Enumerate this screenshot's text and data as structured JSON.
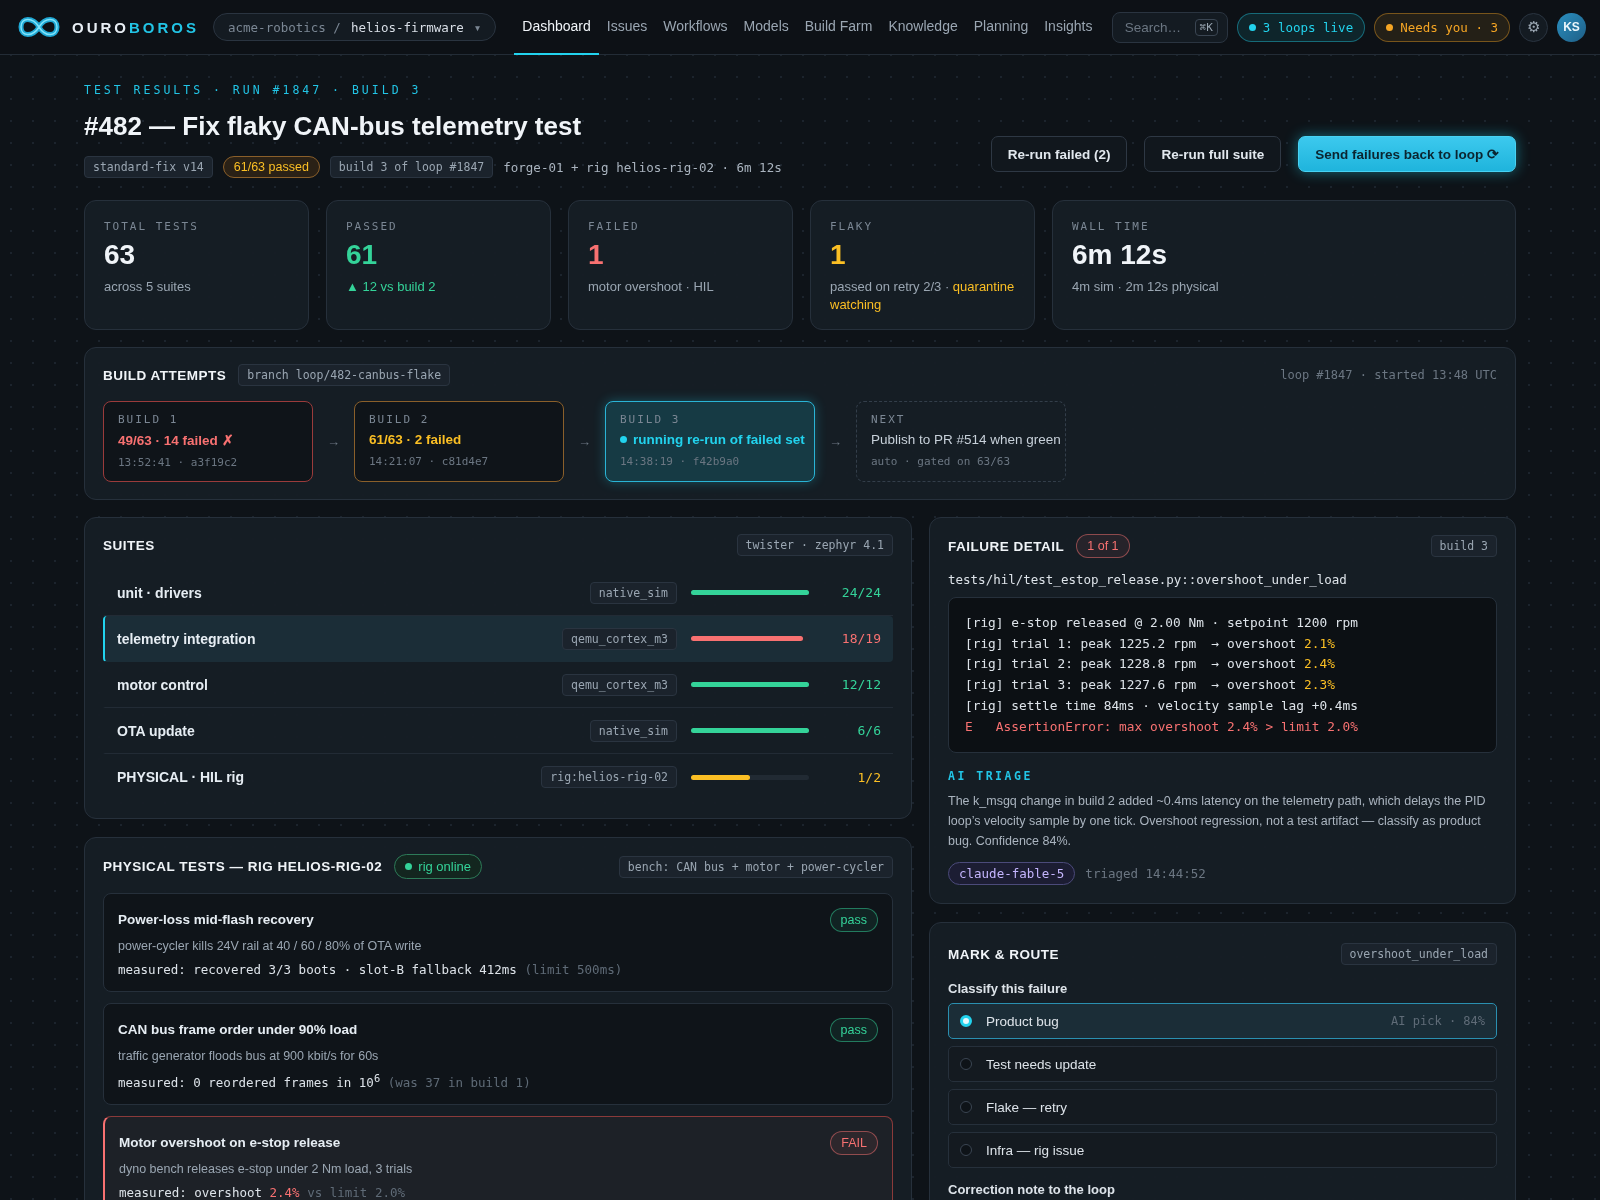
{
  "brand": {
    "name_a": "OURO",
    "name_b": "BOROS"
  },
  "repo": {
    "org": "acme-robotics /",
    "name": "helios-firmware",
    "caret": "▾"
  },
  "nav": [
    {
      "label": "Dashboard",
      "selected": true
    },
    {
      "label": "Issues",
      "selected": false
    },
    {
      "label": "Workflows",
      "selected": false
    },
    {
      "label": "Models",
      "selected": false
    },
    {
      "label": "Build Farm",
      "selected": false
    },
    {
      "label": "Knowledge",
      "selected": false
    },
    {
      "label": "Planning",
      "selected": false
    },
    {
      "label": "Insights",
      "selected": false
    }
  ],
  "search": {
    "placeholder": "Search…",
    "shortcut": "⌘K"
  },
  "status_pills": [
    {
      "label": "3 loops live",
      "color": "#22d3ee"
    },
    {
      "label": "Needs you · 3",
      "color": "#f5a524"
    }
  ],
  "settings": {
    "glyph": "⚙"
  },
  "avatar": {
    "initials": "KS"
  },
  "header": {
    "eyebrow": "TEST RESULTS · RUN #1847 · BUILD 3",
    "title": "#482 — Fix flaky CAN-bus telemetry test",
    "tags": [
      {
        "label": "standard-fix v14",
        "kind": "code"
      },
      {
        "label": "61/63 passed",
        "kind": "warn"
      },
      {
        "label": "build 3 of loop #1847",
        "kind": "code"
      }
    ],
    "meta": "forge-01 + rig helios-rig-02 · 6m 12s",
    "actions": [
      {
        "label": "Re-run failed (2)",
        "kind": "secondary"
      },
      {
        "label": "Re-run full suite",
        "kind": "secondary"
      },
      {
        "label": "Send failures back to loop ⟳",
        "kind": "primary"
      }
    ]
  },
  "stats": [
    {
      "label": "TOTAL TESTS",
      "value": "63",
      "kind": "neutral",
      "note": "across 5 suites"
    },
    {
      "label": "PASSED",
      "value": "61",
      "kind": "pass",
      "note": "▲ 12 vs build 2"
    },
    {
      "label": "FAILED",
      "value": "1",
      "kind": "fail",
      "note": "motor overshoot · HIL"
    },
    {
      "label": "FLAKY",
      "value": "1",
      "kind": "warn",
      "note": "passed on retry 2/3 ·",
      "note_accent": "quarantine watching"
    },
    {
      "label": "WALL TIME",
      "value": "6m 12s",
      "kind": "neutral",
      "note": "4m sim · 2m 12s physical"
    }
  ],
  "build_attempts": {
    "title": "BUILD ATTEMPTS",
    "branch": "branch loop/482-canbus-flake",
    "meta": "loop #1847 · started 13:48 UTC",
    "attempts": [
      {
        "label": "BUILD 1",
        "result": "49/63 · 14 failed ✗",
        "meta": "13:52:41 · a3f19c2",
        "kind": "failed",
        "arrow_after": "→"
      },
      {
        "label": "BUILD 2",
        "result": "61/63 · 2 failed",
        "meta": "14:21:07 · c81d4e7",
        "kind": "partial",
        "arrow_after": "→"
      },
      {
        "label": "BUILD 3",
        "result": "running re-run of failed set",
        "meta": "14:38:19 · f42b9a0",
        "kind": "running",
        "arrow_after": "→"
      },
      {
        "label": "NEXT",
        "result": "Publish to PR #514 when green",
        "meta": "auto · gated on 63/63",
        "kind": "next"
      }
    ]
  },
  "suites": {
    "title": "SUITES",
    "tag": "twister · zephyr 4.1",
    "rows": [
      {
        "name": "unit · drivers",
        "platform": "native_sim",
        "level": 1,
        "count": "24/24",
        "kind": "pass",
        "selected": false
      },
      {
        "name": "telemetry integration",
        "platform": "qemu_cortex_m3",
        "level": 0.95,
        "count": "18/19",
        "kind": "fail",
        "selected": true
      },
      {
        "name": "motor control",
        "platform": "qemu_cortex_m3",
        "level": 1,
        "count": "12/12",
        "kind": "pass",
        "selected": false
      },
      {
        "name": "OTA update",
        "platform": "native_sim",
        "level": 1,
        "count": "6/6",
        "kind": "pass",
        "selected": false
      },
      {
        "name": "PHYSICAL · HIL rig",
        "platform": "rig:helios-rig-02",
        "level": 0.5,
        "count": "1/2",
        "kind": "partial",
        "selected": false
      }
    ]
  },
  "physical_tests": {
    "title": "PHYSICAL TESTS — RIG HELIOS-RIG-02",
    "rig_status": {
      "label": "rig online",
      "color": "#34d399"
    },
    "bench": "bench: CAN bus + motor + power-cycler",
    "tests": [
      {
        "title": "Power-loss mid-flash recovery",
        "description": "power-cycler kills 24V rail at 40 / 60 / 80% of OTA write",
        "measured": "measured: recovered 3/3 boots · slot-B fallback 412ms",
        "measured_note": "(limit 500ms)",
        "result": "pass",
        "kind": "pass"
      },
      {
        "title": "CAN bus frame order under 90% load",
        "description": "traffic generator floods bus at 900 kbit/s for 60s",
        "measured": "measured: 0 reordered frames in 10$^{6}$",
        "measured_note": "(was 37 in build 1)",
        "result": "pass",
        "kind": "pass"
      },
      {
        "title": "Motor overshoot on e-stop release",
        "description": "dyno bench releases e-stop under 2 Nm load, 3 trials",
        "measured": "measured: overshoot",
        "measured_value": "2.4%",
        "measured_note": "vs limit 2.0%",
        "result": "FAIL",
        "kind": "fail"
      }
    ]
  },
  "failure_detail": {
    "title": "FAILURE DETAIL",
    "count": "1 of 1",
    "tag": "build 3",
    "test_path": "tests/hil/test_estop_release.py::overshoot_under_load",
    "log": [
      {
        "kind": "info",
        "text": "[rig] e-stop released @ 2.00 Nm · setpoint 1200 rpm"
      },
      {
        "kind": "trial",
        "text": "[rig] trial 1: peak 1225.2 rpm  → overshoot",
        "value": "2.1%"
      },
      {
        "kind": "trial",
        "text": "[rig] trial 2: peak 1228.8 rpm  → overshoot",
        "value": "2.4%"
      },
      {
        "kind": "trial",
        "text": "[rig] trial 3: peak 1227.6 rpm  → overshoot",
        "value": "2.3%"
      },
      {
        "kind": "info",
        "text": "[rig] settle time 84ms · velocity sample lag +0.4ms"
      },
      {
        "kind": "error",
        "prefix": "E",
        "text": "AssertionError: max overshoot 2.4% > limit 2.0%"
      }
    ],
    "triage_heading": "AI TRIAGE",
    "triage_text": "The k_msgq change in build 2 added ~0.4ms latency on the telemetry path, which delays the PID loop’s velocity sample by one tick. Overshoot regression, not a test artifact — classify as product bug. Confidence 84%.",
    "model": "claude-fable-5",
    "triaged": "triaged 14:44:52"
  },
  "mark_route": {
    "title": "MARK & ROUTE",
    "tag": "overshoot_under_load",
    "prompt": "Classify this failure",
    "options": [
      {
        "label": "Product bug",
        "hint": "AI pick · 84%",
        "selected": true
      },
      {
        "label": "Test needs update",
        "selected": false
      },
      {
        "label": "Flake — retry",
        "selected": false
      },
      {
        "label": "Infra — rig issue",
        "selected": false
      }
    ],
    "note_label": "Correction note to the loop"
  }
}
